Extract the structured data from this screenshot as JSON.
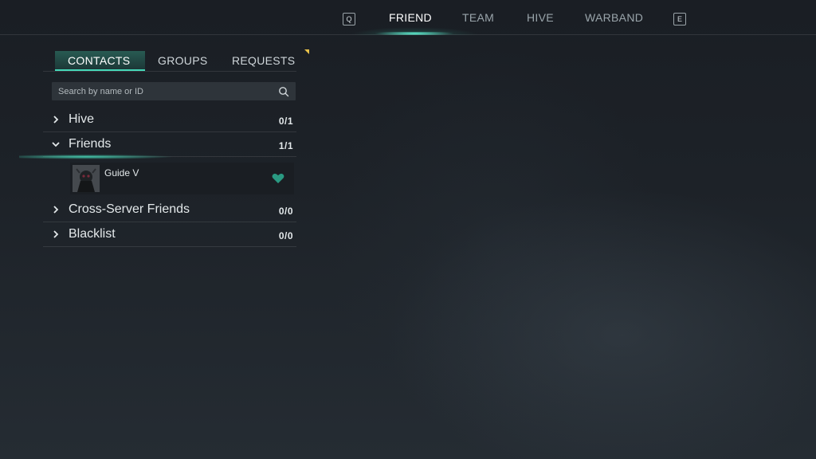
{
  "top_nav": {
    "prev_key": "Q",
    "next_key": "E",
    "tabs": [
      {
        "label": "FRIEND",
        "active": true
      },
      {
        "label": "TEAM",
        "active": false
      },
      {
        "label": "HIVE",
        "active": false
      },
      {
        "label": "WARBAND",
        "active": false
      }
    ]
  },
  "panel": {
    "subtabs": [
      {
        "label": "CONTACTS",
        "active": true
      },
      {
        "label": "GROUPS",
        "active": false
      },
      {
        "label": "REQUESTS",
        "active": false
      }
    ],
    "search": {
      "placeholder": "Search by name or ID",
      "value": ""
    },
    "groups": [
      {
        "label": "Hive",
        "count": "0/1",
        "expanded": false
      },
      {
        "label": "Friends",
        "count": "1/1",
        "expanded": true
      },
      {
        "label": "Cross-Server Friends",
        "count": "0/0",
        "expanded": false
      },
      {
        "label": "Blacklist",
        "count": "0/0",
        "expanded": false
      }
    ],
    "friends": [
      {
        "name": "Guide V",
        "icon": "heart-icon"
      }
    ]
  },
  "colors": {
    "accent": "#46d8b8",
    "notify": "#e8c14a",
    "heart": "#2a9a82"
  }
}
